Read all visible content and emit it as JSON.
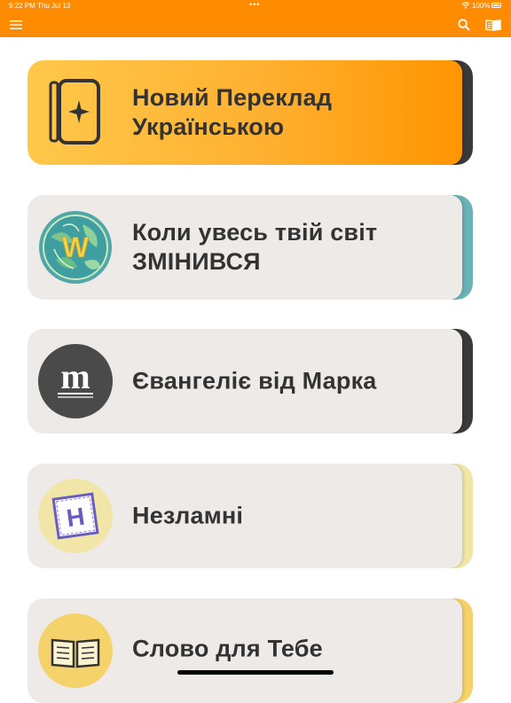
{
  "status_bar": {
    "time": "9:22 PM",
    "date": "Thu Jul 13",
    "dots": "•••",
    "battery": "100%"
  },
  "navbar": {
    "background": "#ff8c00",
    "left_icon": "hamburger-menu-icon",
    "right_icons": [
      "search-icon",
      "open-book-icon"
    ]
  },
  "apps": [
    {
      "line1": "Новий Переклад",
      "line2": "Українською",
      "icon": "tablet-star-icon",
      "face_color": "#ffb833",
      "accent_color": "#3a3a3a"
    },
    {
      "line1": "Коли увесь твій світ",
      "line2": "ЗМІНИВСЯ",
      "icon": "w-leaf-logo",
      "logo_letter": "W",
      "face_color": "#edeae7",
      "accent_color": "#6ab3b6"
    },
    {
      "line1": "Євангеліє від Марка",
      "icon": "m-logo",
      "logo_letter": "m",
      "face_color": "#edeae7",
      "accent_color": "#3a3a3a"
    },
    {
      "line1": "Незламні",
      "icon": "h-sticker-logo",
      "logo_letter": "H",
      "face_color": "#edeae7",
      "accent_color": "#f1e6a8"
    },
    {
      "line1": "Слово для Тебе",
      "icon": "book-logo",
      "face_color": "#edeae7",
      "accent_color": "#f6d26b"
    }
  ]
}
